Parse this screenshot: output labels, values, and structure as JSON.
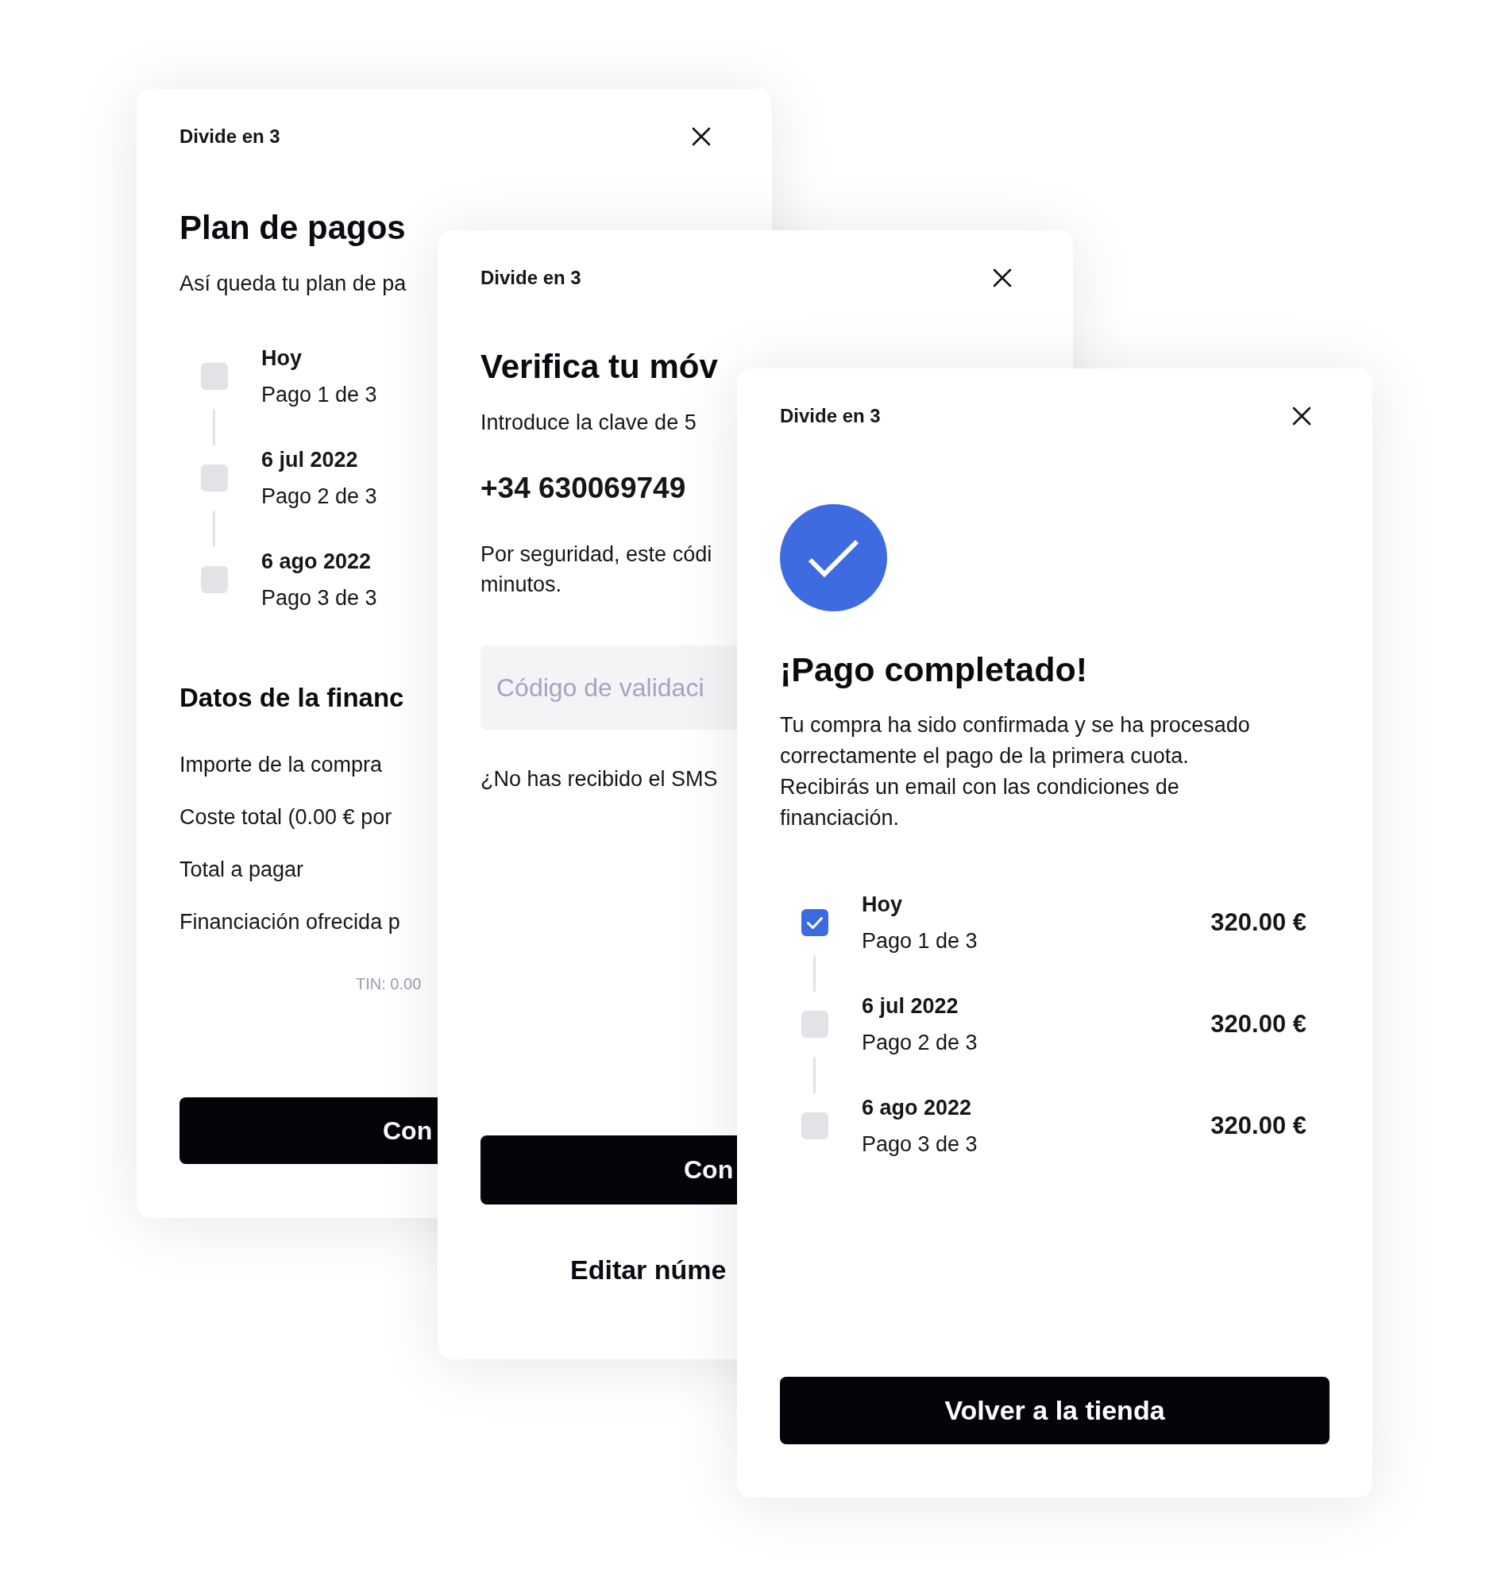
{
  "dialogs": [
    {
      "kind": "payment_plan",
      "title": "Divide en 3",
      "heading": "Plan de pagos",
      "subtitle": "Así queda tu plan de pa",
      "payments": [
        {
          "date": "Hoy",
          "label": "Pago 1 de 3",
          "checked": false
        },
        {
          "date": "6 jul 2022",
          "label": "Pago 2 de 3",
          "checked": false
        },
        {
          "date": "6 ago 2022",
          "label": "Pago 3 de 3",
          "checked": false
        }
      ],
      "section_title": "Datos de la financ",
      "details": [
        "Importe de la compra",
        "Coste total (0.00 € por",
        "Total a pagar",
        "Financiación ofrecida p"
      ],
      "rates_note": "TIN: 0.00",
      "button": "Con"
    },
    {
      "kind": "verify_phone",
      "title": "Divide en 3",
      "heading": "Verifica tu móv",
      "subtitle": "Introduce la clave de 5",
      "phone": "+34 630069749",
      "security_note": [
        "Por seguridad, este códi",
        "minutos."
      ],
      "code_field": {
        "placeholder": "Código de validaci"
      },
      "resend_prompt": "¿No has recibido el SMS",
      "button": "Con",
      "edit_link": "Editar núme"
    },
    {
      "kind": "payment_complete",
      "title": "Divide en 3",
      "heading": "¡Pago completado!",
      "message": [
        "Tu compra ha sido confirmada y se ha procesado",
        "correctamente el pago de la primera cuota.",
        "Recibirás un email con las condiciones de",
        "financiación."
      ],
      "payments": [
        {
          "date": "Hoy",
          "label": "Pago 1 de 3",
          "amount": "320.00 €",
          "checked": true
        },
        {
          "date": "6 jul 2022",
          "label": "Pago 2 de 3",
          "amount": "320.00 €",
          "checked": false
        },
        {
          "date": "6 ago 2022",
          "label": "Pago 3 de 3",
          "amount": "320.00 €",
          "checked": false
        }
      ],
      "button": "Volver a la tienda"
    }
  ]
}
